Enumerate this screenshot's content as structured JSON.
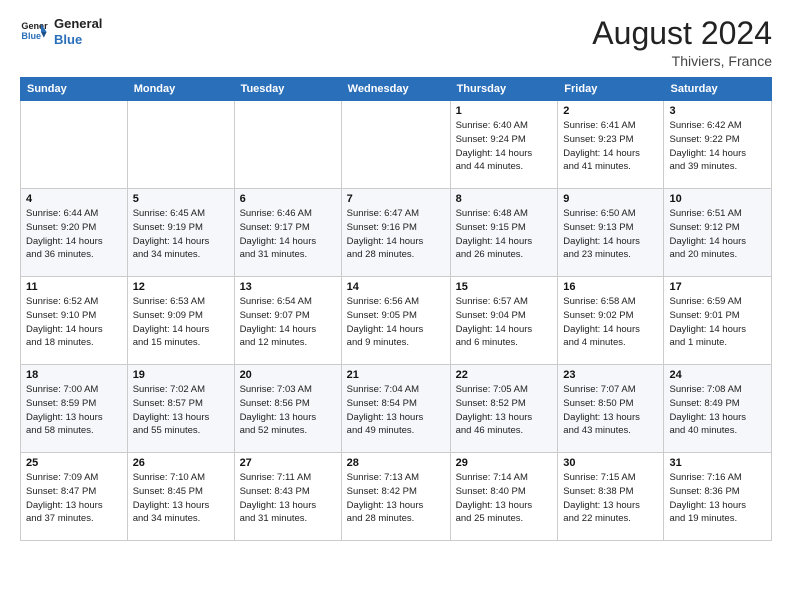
{
  "header": {
    "logo_line1": "General",
    "logo_line2": "Blue",
    "month_year": "August 2024",
    "location": "Thiviers, France"
  },
  "days_of_week": [
    "Sunday",
    "Monday",
    "Tuesday",
    "Wednesday",
    "Thursday",
    "Friday",
    "Saturday"
  ],
  "weeks": [
    [
      {
        "num": "",
        "info": ""
      },
      {
        "num": "",
        "info": ""
      },
      {
        "num": "",
        "info": ""
      },
      {
        "num": "",
        "info": ""
      },
      {
        "num": "1",
        "info": "Sunrise: 6:40 AM\nSunset: 9:24 PM\nDaylight: 14 hours\nand 44 minutes."
      },
      {
        "num": "2",
        "info": "Sunrise: 6:41 AM\nSunset: 9:23 PM\nDaylight: 14 hours\nand 41 minutes."
      },
      {
        "num": "3",
        "info": "Sunrise: 6:42 AM\nSunset: 9:22 PM\nDaylight: 14 hours\nand 39 minutes."
      }
    ],
    [
      {
        "num": "4",
        "info": "Sunrise: 6:44 AM\nSunset: 9:20 PM\nDaylight: 14 hours\nand 36 minutes."
      },
      {
        "num": "5",
        "info": "Sunrise: 6:45 AM\nSunset: 9:19 PM\nDaylight: 14 hours\nand 34 minutes."
      },
      {
        "num": "6",
        "info": "Sunrise: 6:46 AM\nSunset: 9:17 PM\nDaylight: 14 hours\nand 31 minutes."
      },
      {
        "num": "7",
        "info": "Sunrise: 6:47 AM\nSunset: 9:16 PM\nDaylight: 14 hours\nand 28 minutes."
      },
      {
        "num": "8",
        "info": "Sunrise: 6:48 AM\nSunset: 9:15 PM\nDaylight: 14 hours\nand 26 minutes."
      },
      {
        "num": "9",
        "info": "Sunrise: 6:50 AM\nSunset: 9:13 PM\nDaylight: 14 hours\nand 23 minutes."
      },
      {
        "num": "10",
        "info": "Sunrise: 6:51 AM\nSunset: 9:12 PM\nDaylight: 14 hours\nand 20 minutes."
      }
    ],
    [
      {
        "num": "11",
        "info": "Sunrise: 6:52 AM\nSunset: 9:10 PM\nDaylight: 14 hours\nand 18 minutes."
      },
      {
        "num": "12",
        "info": "Sunrise: 6:53 AM\nSunset: 9:09 PM\nDaylight: 14 hours\nand 15 minutes."
      },
      {
        "num": "13",
        "info": "Sunrise: 6:54 AM\nSunset: 9:07 PM\nDaylight: 14 hours\nand 12 minutes."
      },
      {
        "num": "14",
        "info": "Sunrise: 6:56 AM\nSunset: 9:05 PM\nDaylight: 14 hours\nand 9 minutes."
      },
      {
        "num": "15",
        "info": "Sunrise: 6:57 AM\nSunset: 9:04 PM\nDaylight: 14 hours\nand 6 minutes."
      },
      {
        "num": "16",
        "info": "Sunrise: 6:58 AM\nSunset: 9:02 PM\nDaylight: 14 hours\nand 4 minutes."
      },
      {
        "num": "17",
        "info": "Sunrise: 6:59 AM\nSunset: 9:01 PM\nDaylight: 14 hours\nand 1 minute."
      }
    ],
    [
      {
        "num": "18",
        "info": "Sunrise: 7:00 AM\nSunset: 8:59 PM\nDaylight: 13 hours\nand 58 minutes."
      },
      {
        "num": "19",
        "info": "Sunrise: 7:02 AM\nSunset: 8:57 PM\nDaylight: 13 hours\nand 55 minutes."
      },
      {
        "num": "20",
        "info": "Sunrise: 7:03 AM\nSunset: 8:56 PM\nDaylight: 13 hours\nand 52 minutes."
      },
      {
        "num": "21",
        "info": "Sunrise: 7:04 AM\nSunset: 8:54 PM\nDaylight: 13 hours\nand 49 minutes."
      },
      {
        "num": "22",
        "info": "Sunrise: 7:05 AM\nSunset: 8:52 PM\nDaylight: 13 hours\nand 46 minutes."
      },
      {
        "num": "23",
        "info": "Sunrise: 7:07 AM\nSunset: 8:50 PM\nDaylight: 13 hours\nand 43 minutes."
      },
      {
        "num": "24",
        "info": "Sunrise: 7:08 AM\nSunset: 8:49 PM\nDaylight: 13 hours\nand 40 minutes."
      }
    ],
    [
      {
        "num": "25",
        "info": "Sunrise: 7:09 AM\nSunset: 8:47 PM\nDaylight: 13 hours\nand 37 minutes."
      },
      {
        "num": "26",
        "info": "Sunrise: 7:10 AM\nSunset: 8:45 PM\nDaylight: 13 hours\nand 34 minutes."
      },
      {
        "num": "27",
        "info": "Sunrise: 7:11 AM\nSunset: 8:43 PM\nDaylight: 13 hours\nand 31 minutes."
      },
      {
        "num": "28",
        "info": "Sunrise: 7:13 AM\nSunset: 8:42 PM\nDaylight: 13 hours\nand 28 minutes."
      },
      {
        "num": "29",
        "info": "Sunrise: 7:14 AM\nSunset: 8:40 PM\nDaylight: 13 hours\nand 25 minutes."
      },
      {
        "num": "30",
        "info": "Sunrise: 7:15 AM\nSunset: 8:38 PM\nDaylight: 13 hours\nand 22 minutes."
      },
      {
        "num": "31",
        "info": "Sunrise: 7:16 AM\nSunset: 8:36 PM\nDaylight: 13 hours\nand 19 minutes."
      }
    ]
  ]
}
